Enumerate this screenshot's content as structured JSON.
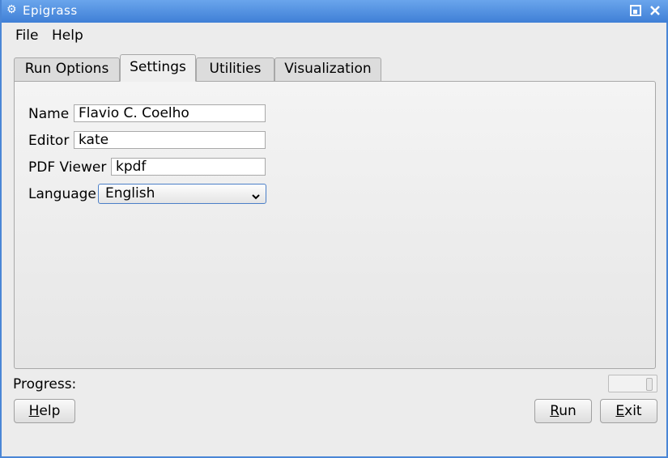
{
  "window": {
    "title": "Epigrass",
    "accent_color": "#4a86d6"
  },
  "titlebar": {
    "app_icon": "kde-gear-icon",
    "restore_icon": "restore-icon",
    "close_icon": "close-icon"
  },
  "menu": {
    "file": "File",
    "help": "Help"
  },
  "tabs": [
    {
      "label": "Run Options",
      "active": false
    },
    {
      "label": "Settings",
      "active": true
    },
    {
      "label": "Utilities",
      "active": false
    },
    {
      "label": "Visualization",
      "active": false
    }
  ],
  "settings": {
    "name_label": "Name",
    "name_value": "Flavio C. Coelho",
    "editor_label": "Editor",
    "editor_value": "kate",
    "pdf_label": "PDF Viewer",
    "pdf_value": "kpdf",
    "language_label": "Language",
    "language_value": "English"
  },
  "progress": {
    "label": "Progress:",
    "value": 0
  },
  "buttons": {
    "help_prefix": "",
    "help_mnemonic": "H",
    "help_rest": "elp",
    "run_mnemonic": "R",
    "run_rest": "un",
    "exit_mnemonic": "E",
    "exit_rest": "xit"
  }
}
